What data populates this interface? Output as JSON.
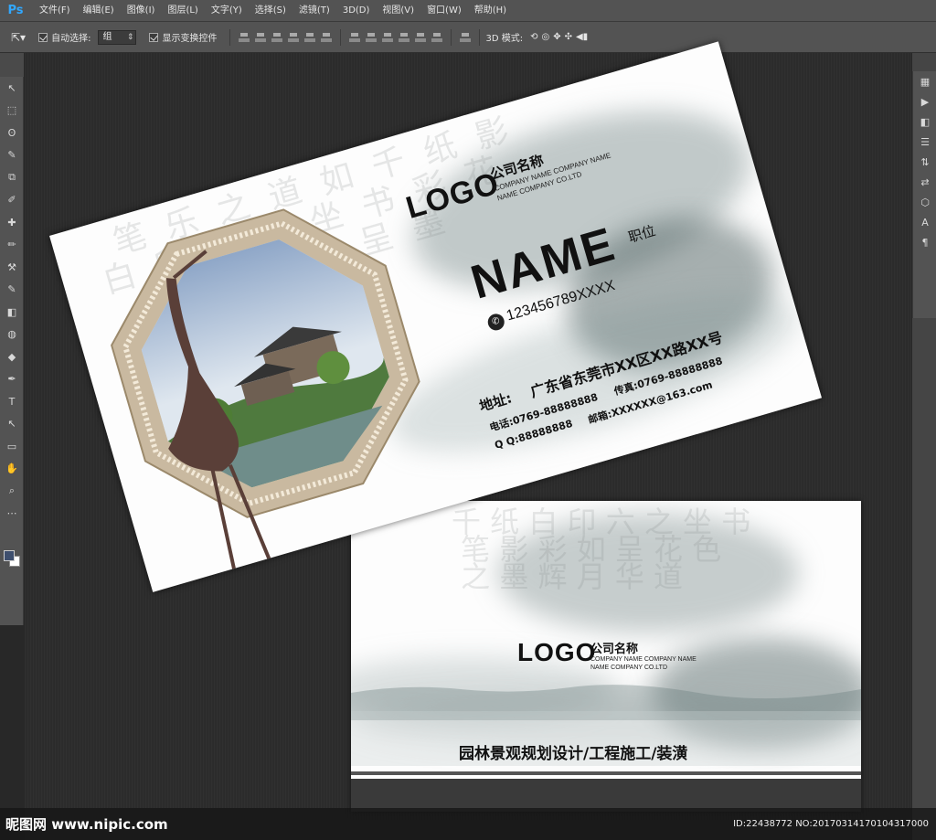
{
  "app": {
    "logo": "Ps"
  },
  "menu": [
    "文件(F)",
    "编辑(E)",
    "图像(I)",
    "图层(L)",
    "文字(Y)",
    "选择(S)",
    "滤镜(T)",
    "3D(D)",
    "视图(V)",
    "窗口(W)",
    "帮助(H)"
  ],
  "options": {
    "auto_select_label": "自动选择:",
    "auto_select_value": "组",
    "show_transform_label": "显示变换控件",
    "mode_3d_label": "3D 模式:"
  },
  "tools_left": [
    "↖",
    "⬚",
    "ʘ",
    "✎",
    "⧉",
    "✐",
    "✚",
    "✏",
    "⚒",
    "✎",
    "◧",
    "◍",
    "◆",
    "✒",
    "T",
    "↖",
    "▭",
    "✋",
    "⌕",
    "⋯"
  ],
  "tools_right": [
    "▦",
    "▶",
    "◧",
    "☰",
    "⇅",
    "⇄",
    "⬡",
    "A",
    "¶"
  ],
  "front_card": {
    "logo": "LOGO",
    "company_cn": "公司名称",
    "company_en_1": "COMPANY NAME COMPANY NAME",
    "company_en_2": "NAME COMPANY CO.LTD",
    "name": "NAME",
    "title": "职位",
    "phone": "123456789XXXX",
    "address_label": "地址:",
    "address": "广东省东莞市XX区XX路XX号",
    "tel": "电话:0769-88888888",
    "fax": "传真:0769-88888888",
    "qq": "Q Q:88888888",
    "email": "邮箱:XXXXXX@163.com"
  },
  "back_card": {
    "logo": "LOGO",
    "company_cn": "公司名称",
    "company_en_1": "COMPANY NAME COMPANY NAME",
    "company_en_2": "NAME COMPANY CO.LTD",
    "slogan": "园林景观规划设计/工程施工/装潢"
  },
  "watermark": {
    "site": "昵图网 www.nipic.com",
    "id": "ID:22438772 NO:20170314170104317000"
  },
  "colors": {
    "ui_bg": "#535353",
    "canvas_bg": "#2b2b2b",
    "ink": "#5f7474",
    "frame": "#b7a58a"
  }
}
